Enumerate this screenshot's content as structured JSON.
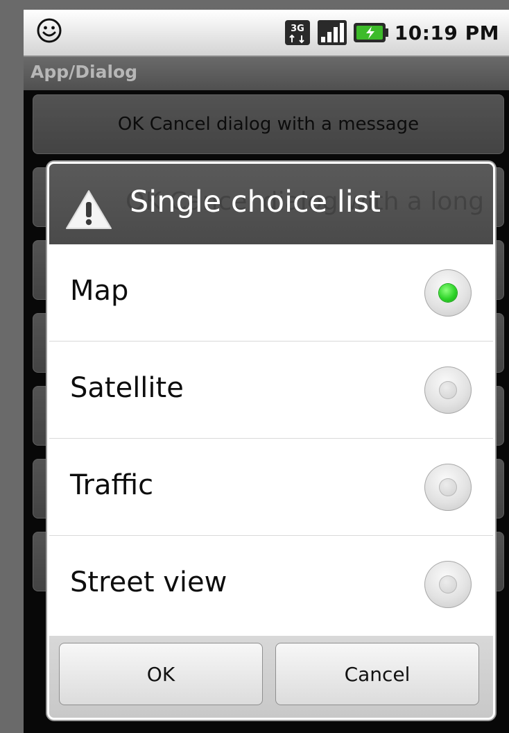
{
  "status_bar": {
    "time": "10:19 PM",
    "network_label": "3G",
    "icons": [
      "smiley-icon",
      "network-3g-icon",
      "signal-icon",
      "battery-charging-icon"
    ]
  },
  "app": {
    "title": "App/Dialog"
  },
  "background_buttons": [
    "OK Cancel dialog with a message",
    "OK Cancel dialog with a long message"
  ],
  "dialog": {
    "title": "Single choice list",
    "icon": "warning-icon",
    "options": [
      {
        "label": "Map",
        "checked": true
      },
      {
        "label": "Satellite",
        "checked": false
      },
      {
        "label": "Traffic",
        "checked": false
      },
      {
        "label": "Street view",
        "checked": false
      }
    ],
    "ok_label": "OK",
    "cancel_label": "Cancel"
  },
  "colors": {
    "radio_checked": "#2fd42a",
    "dialog_header": "#505050",
    "background": "#0b0b0b"
  }
}
